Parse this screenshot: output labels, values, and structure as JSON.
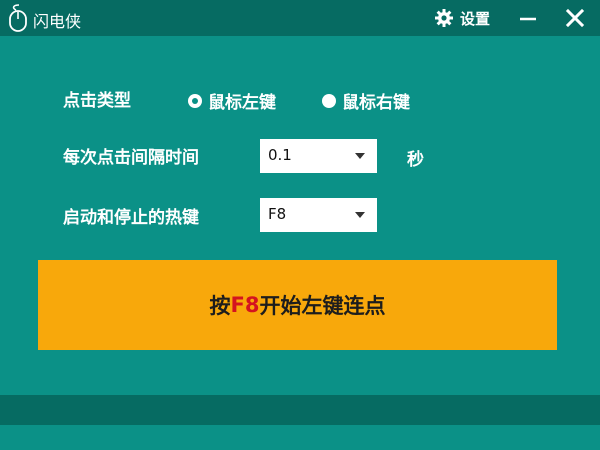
{
  "window": {
    "title": "闪电侠"
  },
  "titlebar": {
    "settings_label": "设置",
    "settings_icon": "gear-icon",
    "minimize_icon": "minimize-icon",
    "close_icon": "close-icon"
  },
  "click_type": {
    "label": "点击类型",
    "options": [
      {
        "label": "鼠标左键",
        "selected": true
      },
      {
        "label": "鼠标右键",
        "selected": false
      }
    ]
  },
  "interval": {
    "label": "每次点击间隔时间",
    "value": "0.1",
    "unit": "秒"
  },
  "hotkey": {
    "label": "启动和停止的热键",
    "value": "F8"
  },
  "start_button": {
    "prefix": "按",
    "key": "F8",
    "suffix": "开始左键连点"
  },
  "colors": {
    "background": "#0b9187",
    "bars": "#066b62",
    "button": "#f8a80b",
    "key_highlight": "#d4131f"
  }
}
